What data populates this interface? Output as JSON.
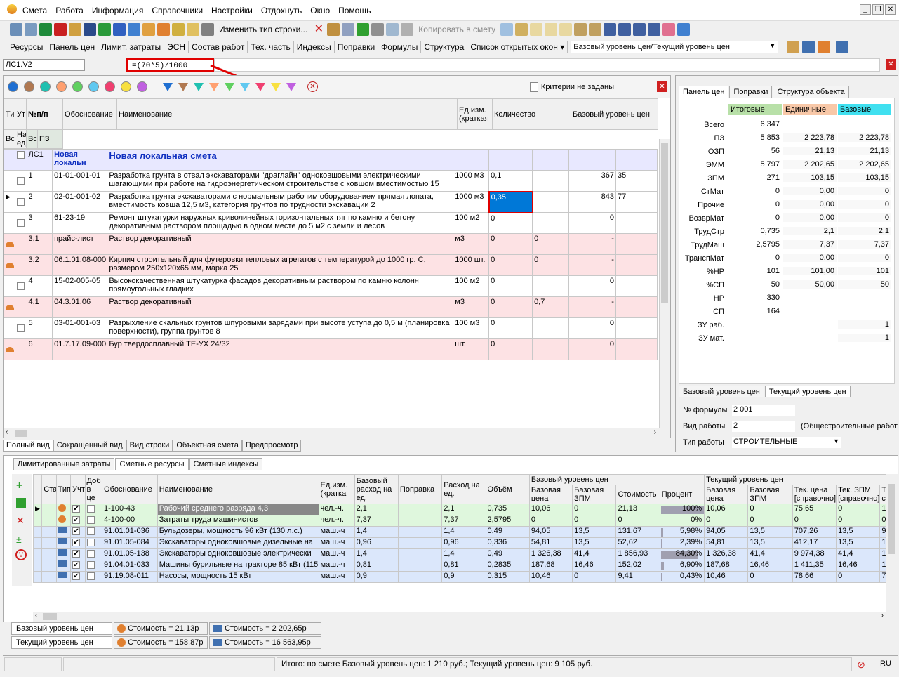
{
  "menu": [
    "Смета",
    "Работа",
    "Информация",
    "Справочники",
    "Настройки",
    "Отдохнуть",
    "Окно",
    "Помощь"
  ],
  "toolbar": {
    "change_row_type": "Изменить тип строки...",
    "copy_to_estimate": "Копировать в смету"
  },
  "toolbar2": [
    "Ресурсы",
    "Панель цен",
    "Лимит. затраты",
    "ЭСН",
    "Состав работ",
    "Тех. часть",
    "Индексы",
    "Поправки",
    "Формулы",
    "Структура",
    "Список открытых окон ▾"
  ],
  "price_level_select": "Базовый уровень цен/Текущий уровень цен",
  "cell_ref": "ЛС1.V2",
  "formula": "=(70*5)/1000",
  "criteria": "Критерии не заданы",
  "colors": {
    "dots": [
      "#1f6fd1",
      "#b07850",
      "#20c0b0",
      "#ffa070",
      "#60d060",
      "#60c8f0",
      "#f04070",
      "#f8e040",
      "#c060e0"
    ],
    "filters": [
      "#1f6fd1",
      "#b07850",
      "#20c0b0",
      "#ffa070",
      "#60d060",
      "#60c8f0",
      "#f04070",
      "#f8e040",
      "#c060e0"
    ]
  },
  "main_table": {
    "headers": {
      "ti": "Ти",
      "ut": "Ут",
      "num": "№п/п",
      "basis": "Обоснование",
      "name": "Наименование",
      "unit": "Ед.изм. (краткая",
      "qty": "Количество",
      "qty_total": "Всего",
      "qty_unit": "На единицу",
      "base": "Базовый уровень цен",
      "base_total": "Всего",
      "pz": "ПЗ"
    },
    "local_row": {
      "num": "ЛС1",
      "basis": "Новая локальн",
      "name": "Новая локальная смета"
    },
    "rows": [
      {
        "num": "1",
        "basis": "01-01-001-01",
        "name": "Разработка грунта в отвал экскаваторами \"драглайн\" одноковшовыми электрическими шагающими при работе на гидроэнергетическом строительстве с ковшом вместимостью 15",
        "unit": "1000 м3",
        "qty": "0,1",
        "qunit": "",
        "total": "367",
        "pz": "35",
        "pink": false
      },
      {
        "num": "2",
        "basis": "02-01-001-02",
        "name": "Разработка грунта экскаваторами с нормальным рабочим оборудованием прямая лопата, вместимость ковша 12,5 м3, категория грунтов по трудности экскавации 2",
        "unit": "1000 м3",
        "qty": "0,35",
        "qunit": "",
        "total": "843",
        "pz": "77",
        "pink": false,
        "sel": true
      },
      {
        "num": "3",
        "basis": "61-23-19",
        "name": "Ремонт штукатурки наружных криволинейных горизонтальных тяг по камню и бетону декоративным раствором площадью в одном месте до 5 м2 с земли и лесов",
        "unit": "100 м2",
        "qty": "0",
        "qunit": "",
        "total": "0",
        "pz": "",
        "pink": false
      },
      {
        "num": "3,1",
        "basis": "прайс-лист",
        "name": "Раствор декоративный",
        "unit": "м3",
        "qty": "0",
        "qunit": "0",
        "total": "-",
        "pz": "",
        "pink": true
      },
      {
        "num": "3,2",
        "basis": "06.1.01.08-000",
        "name": "Кирпич строительный для футеровки тепловых агрегатов с температурой до 1000 гр. С, размером 250х120х65 мм, марка 25",
        "unit": "1000 шт.",
        "qty": "0",
        "qunit": "0",
        "total": "-",
        "pz": "",
        "pink": true
      },
      {
        "num": "4",
        "basis": "15-02-005-05",
        "name": "Высококачественная штукатурка фасадов декоративным раствором по камню колонн прямоугольных гладких",
        "unit": "100 м2",
        "qty": "0",
        "qunit": "",
        "total": "0",
        "pz": "",
        "pink": false
      },
      {
        "num": "4,1",
        "basis": "04.3.01.06",
        "name": "Раствор декоративный",
        "unit": "м3",
        "qty": "0",
        "qunit": "0,7",
        "total": "-",
        "pz": "",
        "pink": true
      },
      {
        "num": "5",
        "basis": "03-01-001-03",
        "name": "Разрыхление скальных грунтов шпуровыми зарядами при высоте уступа до 0,5 м (планировка поверхности), группа грунтов 8",
        "unit": "100 м3",
        "qty": "0",
        "qunit": "",
        "total": "0",
        "pz": "",
        "pink": false
      },
      {
        "num": "6",
        "basis": "01.7.17.09-000",
        "name": "Бур твердосплавный ТЕ-УХ 24/32",
        "unit": "шт.",
        "qty": "0",
        "qunit": "",
        "total": "0",
        "pz": "",
        "pink": true
      }
    ]
  },
  "view_tabs": [
    "Полный вид",
    "Сокращенный вид",
    "Вид строки",
    "Объектная смета",
    "Предпросмотр"
  ],
  "right_panel": {
    "tabs": [
      "Панель цен",
      "Поправки",
      "Структура объекта"
    ],
    "col_headers": [
      "Итоговые",
      "Единичные",
      "Базовые"
    ],
    "rows": [
      {
        "label": "Всего",
        "a": "6 347",
        "b": "",
        "c": ""
      },
      {
        "label": "ПЗ",
        "a": "5 853",
        "b": "2 223,78",
        "c": "2 223,78"
      },
      {
        "label": "ОЗП",
        "a": "56",
        "b": "21,13",
        "c": "21,13"
      },
      {
        "label": "ЭММ",
        "a": "5 797",
        "b": "2 202,65",
        "c": "2 202,65"
      },
      {
        "label": "ЗПМ",
        "a": "271",
        "b": "103,15",
        "c": "103,15"
      },
      {
        "label": "СтМат",
        "a": "0",
        "b": "0,00",
        "c": "0"
      },
      {
        "label": "Прочие",
        "a": "0",
        "b": "0,00",
        "c": "0"
      },
      {
        "label": "ВозврМат",
        "a": "0",
        "b": "0,00",
        "c": "0"
      },
      {
        "label": "ТрудСтр",
        "a": "0,735",
        "b": "2,1",
        "c": "2,1"
      },
      {
        "label": "ТрудМаш",
        "a": "2,5795",
        "b": "7,37",
        "c": "7,37"
      },
      {
        "label": "ТранспМат",
        "a": "0",
        "b": "0,00",
        "c": "0"
      },
      {
        "label": "%НР",
        "a": "101",
        "b": "101,00",
        "c": "101"
      },
      {
        "label": "%СП",
        "a": "50",
        "b": "50,00",
        "c": "50"
      },
      {
        "label": "НР",
        "a": "330",
        "b": "",
        "c": ""
      },
      {
        "label": "СП",
        "a": "164",
        "b": "",
        "c": ""
      },
      {
        "label": "ЗУ раб.",
        "a": "",
        "b": "",
        "c": "1"
      },
      {
        "label": "ЗУ мат.",
        "a": "",
        "b": "",
        "c": "1"
      }
    ],
    "level_tabs": [
      "Базовый уровень цен",
      "Текущий уровень цен"
    ],
    "formula_no_label": "№ формулы",
    "formula_no": "2 001",
    "work_type_label": "Вид работы",
    "work_type": "2",
    "work_type_desc": "(Общестроительные работ",
    "work_kind_label": "Тип работы",
    "work_kind": "СТРОИТЕЛЬНЫЕ"
  },
  "bottom": {
    "tabs": [
      "Лимитированные затраты",
      "Сметные ресурсы",
      "Сметные индексы"
    ],
    "headers": {
      "st": "Ста",
      "tip": "Тип",
      "uch": "Учт",
      "dob": "Доб в це",
      "basis": "Обоснование",
      "name": "Наименование",
      "unit": "Ед.изм. (кратка",
      "base_rate": "Базовый расход на ед.",
      "corr": "Поправка",
      "rate": "Расход на ед.",
      "vol": "Объём",
      "base_level": "Базовый уровень цен",
      "b_price": "Базовая цена",
      "b_zpm": "Базовая ЗПМ",
      "cost": "Стоимость",
      "pct": "Процент",
      "cur_level": "Текущий уровень цен",
      "c_price": "Базовая цена",
      "c_zpm": "Базовая ЗПМ",
      "t_price": "Тек. цена [справочно]",
      "t_zpm": "Тек. ЗПМ [справочно]",
      "te": "Те сто"
    },
    "rows": [
      {
        "basis": "1-100-43",
        "name": "Рабочий среднего разряда 4,3",
        "unit": "чел.-ч.",
        "brate": "2,1",
        "corr": "",
        "rate": "2,1",
        "vol": "0,735",
        "bprice": "10,06",
        "bzpm": "0",
        "cost": "21,13",
        "pct": "100%",
        "pctv": 1.0,
        "cprice": "10,06",
        "czpm": "0",
        "tprice": "75,65",
        "tzpm": "0",
        "te": "15",
        "type": "green",
        "worker": true
      },
      {
        "basis": "4-100-00",
        "name": "Затраты труда машинистов",
        "unit": "чел.-ч.",
        "brate": "7,37",
        "corr": "",
        "rate": "7,37",
        "vol": "2,5795",
        "bprice": "0",
        "bzpm": "0",
        "cost": "0",
        "pct": "0%",
        "pctv": 0,
        "cprice": "0",
        "czpm": "0",
        "tprice": "0",
        "tzpm": "0",
        "te": "0",
        "type": "green",
        "worker": true
      },
      {
        "basis": "91.01.01-036",
        "name": "Бульдозеры, мощность 96 кВт (130 л.с.)",
        "unit": "маш.-ч",
        "brate": "1,4",
        "corr": "",
        "rate": "1,4",
        "vol": "0,49",
        "bprice": "94,05",
        "bzpm": "13,5",
        "cost": "131,67",
        "pct": "5,98%",
        "pctv": 0.0598,
        "cprice": "94,05",
        "czpm": "13,5",
        "tprice": "707,26",
        "tzpm": "13,5",
        "te": "99",
        "type": "blue",
        "worker": false
      },
      {
        "basis": "91.01.05-084",
        "name": "Экскаваторы одноковшовые дизельные на",
        "unit": "маш.-ч",
        "brate": "0,96",
        "corr": "",
        "rate": "0,96",
        "vol": "0,336",
        "bprice": "54,81",
        "bzpm": "13,5",
        "cost": "52,62",
        "pct": "2,39%",
        "pctv": 0.0239,
        "cprice": "54,81",
        "czpm": "13,5",
        "tprice": "412,17",
        "tzpm": "13,5",
        "te": "18",
        "type": "blue",
        "worker": false
      },
      {
        "basis": "91.01.05-138",
        "name": "Экскаваторы одноковшовые электрически",
        "unit": "маш.-ч",
        "brate": "1,4",
        "corr": "",
        "rate": "1,4",
        "vol": "0,49",
        "bprice": "1 326,38",
        "bzpm": "41,4",
        "cost": "1 856,93",
        "pct": "84,30%",
        "pctv": 0.843,
        "cprice": "1 326,38",
        "czpm": "41,4",
        "tprice": "9 974,38",
        "tzpm": "41,4",
        "te": "13",
        "type": "blue",
        "worker": false
      },
      {
        "basis": "91.04.01-033",
        "name": "Машины бурильные на тракторе 85 кВт (115",
        "unit": "маш.-ч",
        "brate": "0,81",
        "corr": "",
        "rate": "0,81",
        "vol": "0,2835",
        "bprice": "187,68",
        "bzpm": "16,46",
        "cost": "152,02",
        "pct": "6,90%",
        "pctv": 0.069,
        "cprice": "187,68",
        "czpm": "16,46",
        "tprice": "1 411,35",
        "tzpm": "16,46",
        "te": "10",
        "type": "blue",
        "worker": false
      },
      {
        "basis": "91.19.08-011",
        "name": "Насосы, мощность 15 кВт",
        "unit": "маш.-ч",
        "brate": "0,9",
        "corr": "",
        "rate": "0,9",
        "vol": "0,315",
        "bprice": "10,46",
        "bzpm": "0",
        "cost": "9,41",
        "pct": "0,43%",
        "pctv": 0.0043,
        "cprice": "10,46",
        "czpm": "0",
        "tprice": "78,66",
        "tzpm": "0",
        "te": "70",
        "type": "blue",
        "worker": false
      }
    ]
  },
  "footer": {
    "base_label": "Базовый уровень цен",
    "base_worker": "Стоимость = 21,13р",
    "base_machine": "Стоимость = 2 202,65р",
    "cur_label": "Текущий уровень цен",
    "cur_worker": "Стоимость = 158,87р",
    "cur_machine": "Стоимость = 16 563,95р"
  },
  "status": {
    "total": "Итого: по смете Базовый уровень цен: 1 210 руб.; Текущий уровень цен: 9 105 руб.",
    "lang": "RU"
  }
}
